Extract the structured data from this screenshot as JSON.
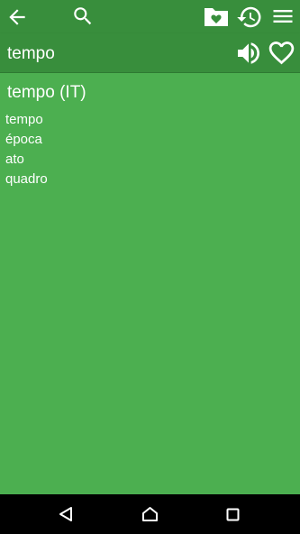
{
  "toolbar": {
    "icons": [
      "back-arrow-icon",
      "search-icon",
      "favorite-folder-icon",
      "history-icon",
      "menu-icon"
    ],
    "background": "#388e3c"
  },
  "word": {
    "text": "tempo",
    "icons": [
      "speaker-icon",
      "heart-outline-icon"
    ]
  },
  "entry": {
    "title": "tempo (IT)",
    "translations": [
      "tempo",
      "época",
      "ato",
      "quadro"
    ]
  },
  "navbar": {
    "icons": [
      "nav-back-icon",
      "nav-home-icon",
      "nav-recents-icon"
    ]
  },
  "colors": {
    "accent": "#388e3c",
    "content_bg": "#4caf50",
    "text": "#ffffff",
    "navbar": "#000000"
  }
}
